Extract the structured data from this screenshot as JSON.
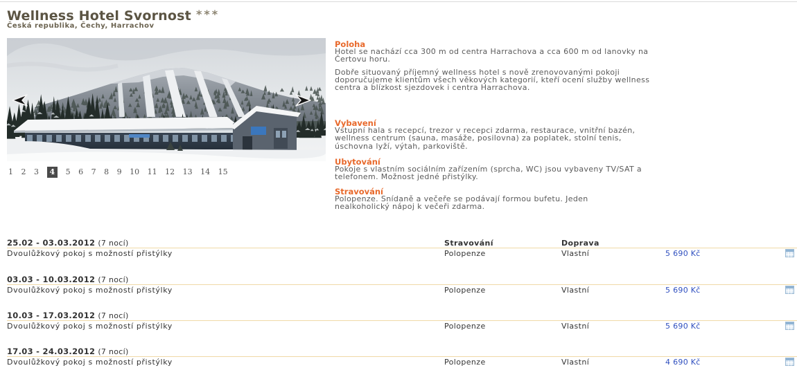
{
  "hotel": {
    "name": "Wellness Hotel Svornost",
    "stars": "***",
    "location": "Česká republika, Čechy, Harrachov"
  },
  "gallery": {
    "pages": [
      "1",
      "2",
      "3",
      "4",
      "5",
      "6",
      "7",
      "8",
      "9",
      "10",
      "11",
      "12",
      "13",
      "14",
      "15"
    ],
    "active_page": "4"
  },
  "icons": {
    "prev": "chevron-left-icon",
    "next": "chevron-right-icon",
    "row_action": "calendar-icon"
  },
  "info": {
    "sections": [
      {
        "heading": "Poloha",
        "paragraphs": [
          [
            "Hotel se nachází cca 300 m od centra Harrachova a cca 600 m od lanovky na",
            "Čertovu horu."
          ],
          [
            "Dobře situovaný příjemný wellness hotel s nově zrenovovanými pokoji",
            "doporučujeme klientům všech věkových kategorií, kteří ocení služby wellness",
            "centra a blízkost sjezdovek i centra Harrachova."
          ]
        ]
      },
      {
        "heading": "Vybavení",
        "paragraphs": [
          [
            "Vstupní hala s recepcí, trezor v recepci zdarma, restaurace, vnitřní bazén,",
            "wellness centrum (sauna, masáže, posilovna) za poplatek, stolní tenis,",
            "úschovna lyží, výtah, parkoviště."
          ]
        ]
      },
      {
        "heading": "Ubytování",
        "paragraphs": [
          [
            "Pokoje s vlastním sociálním zařízením (sprcha, WC) jsou vybaveny TV/SAT a",
            "telefonem. Možnost jedné přistýlky."
          ]
        ]
      },
      {
        "heading": "Stravování",
        "paragraphs": [
          [
            "Polopenze. Snídaně a večeře se podávají formou bufetu. Jeden",
            "nealkoholický nápoj k večeři zdarma."
          ]
        ]
      }
    ]
  },
  "terms": {
    "columns": {
      "board": "Stravování",
      "transport": "Doprava"
    },
    "rows": [
      {
        "dates": "25.02 - 03.03.2012",
        "nights": "(7 nocí)",
        "room": "Dvoulůžkový pokoj s možností přistýlky",
        "board": "Polopenze",
        "transport": "Vlastní",
        "price": "5 690 Kč"
      },
      {
        "dates": "03.03 - 10.03.2012",
        "nights": "(7 nocí)",
        "room": "Dvoulůžkový pokoj s možností přistýlky",
        "board": "Polopenze",
        "transport": "Vlastní",
        "price": "5 690 Kč"
      },
      {
        "dates": "10.03 - 17.03.2012",
        "nights": "(7 nocí)",
        "room": "Dvoulůžkový pokoj s možností přistýlky",
        "board": "Polopenze",
        "transport": "Vlastní",
        "price": "5 690 Kč"
      },
      {
        "dates": "17.03 - 24.03.2012",
        "nights": "(7 nocí)",
        "room": "Dvoulůžkový pokoj s možností přistýlky",
        "board": "Polopenze",
        "transport": "Vlastní",
        "price": "4 690 Kč"
      }
    ]
  },
  "colors": {
    "title": "#5b5443",
    "heading": "#e8692b",
    "price": "#2f4fbf",
    "active_page_bg": "#4a4a4a",
    "separator": "#f0d9a6"
  }
}
